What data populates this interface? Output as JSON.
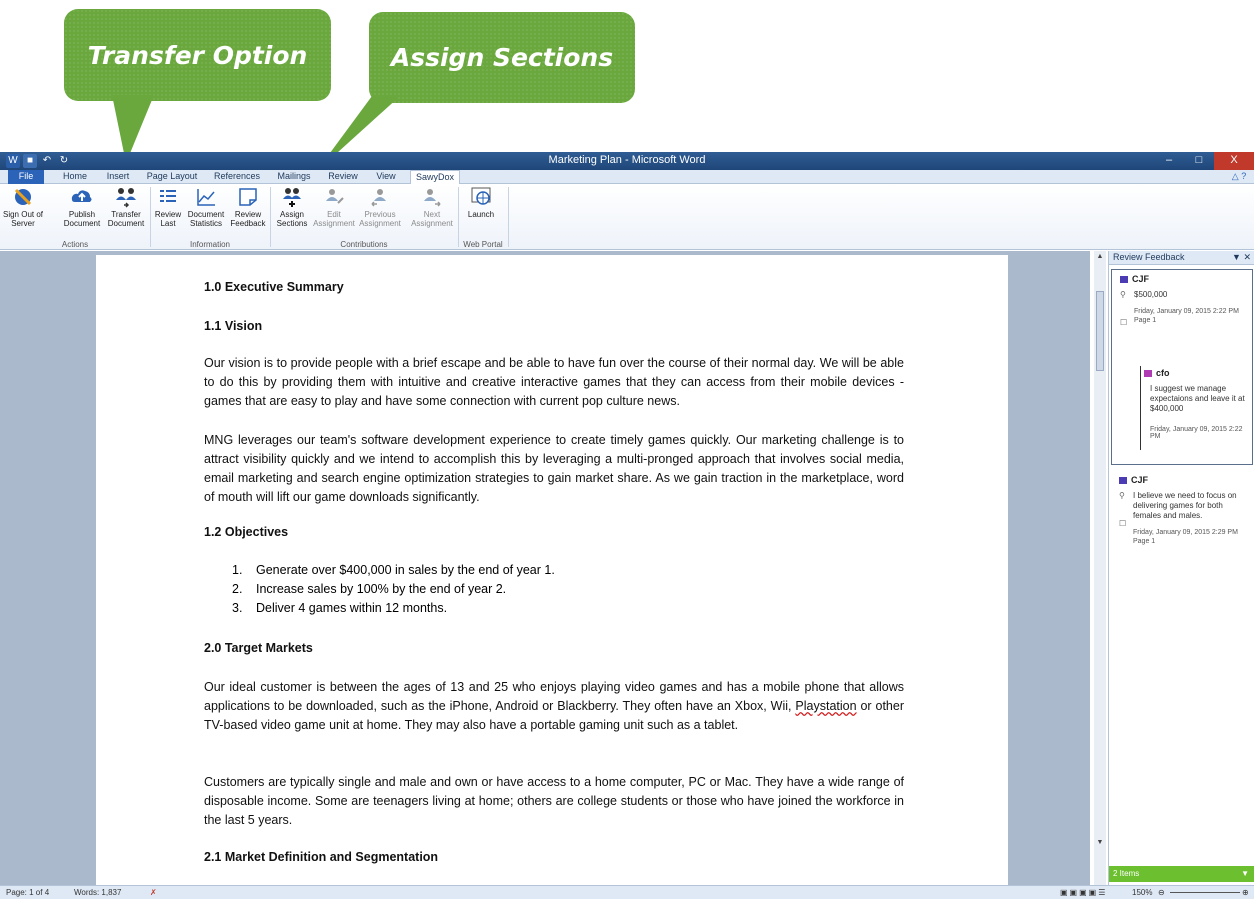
{
  "callouts": {
    "transfer": "Transfer Option",
    "assign": "Assign Sections"
  },
  "window": {
    "title": "Marketing Plan - Microsoft Word",
    "controls": [
      "–",
      "□",
      "X"
    ]
  },
  "tabs": [
    "File",
    "Home",
    "Insert",
    "Page Layout",
    "References",
    "Mailings",
    "Review",
    "View",
    "SawyDox"
  ],
  "ribbon": {
    "actions": {
      "label": "Actions",
      "buttons": [
        {
          "l1": "Sign Out of",
          "l2": "Server"
        },
        {
          "l1": "Publish",
          "l2": "Document"
        },
        {
          "l1": "Transfer",
          "l2": "Document"
        }
      ]
    },
    "information": {
      "label": "Information",
      "buttons": [
        {
          "l1": "Review",
          "l2": "Last"
        },
        {
          "l1": "Document",
          "l2": "Statistics"
        },
        {
          "l1": "Review",
          "l2": "Feedback"
        }
      ]
    },
    "contributions": {
      "label": "Contributions",
      "buttons": [
        {
          "l1": "Assign",
          "l2": "Sections"
        },
        {
          "l1": "Edit",
          "l2": "Assignment"
        },
        {
          "l1": "Previous",
          "l2": "Assignment"
        },
        {
          "l1": "Next",
          "l2": "Assignment"
        }
      ]
    },
    "webportal": {
      "label": "Web Portal",
      "buttons": [
        {
          "l1": "Launch",
          "l2": ""
        }
      ]
    }
  },
  "document": {
    "h1": "1.0 Executive Summary",
    "h2": "1.1 Vision",
    "p1": "Our vision is to provide people with a brief escape and be able to have fun over the course of their normal day. We will be able to do this by providing them with intuitive and creative interactive games that they can access from their mobile devices - games that are easy to play and have some connection with current pop culture news.",
    "p2": "MNG leverages our team's software development experience to create timely games quickly. Our marketing challenge is to attract visibility quickly and we intend to accomplish this by leveraging a multi-pronged approach that involves social media, email marketing and search engine optimization strategies to gain market share. As we gain traction in the marketplace, word of mouth will lift our game downloads significantly.",
    "h3": "1.2 Objectives",
    "objectives": [
      {
        "num": "1.",
        "text": "Generate over $400,000 in sales by the end of year 1."
      },
      {
        "num": "2.",
        "text": "Increase sales by 100% by the end of year 2."
      },
      {
        "num": "3.",
        "text": "Deliver 4 games within 12 months."
      }
    ],
    "h4": "2.0 Target Markets",
    "p3a": "Our ideal customer is between the ages of 13 and 25 who enjoys playing video games and has a mobile phone that allows applications to be downloaded, such as the iPhone, Android or Blackberry. They often have an Xbox, Wii, ",
    "p3word": "Playstation",
    "p3b": " or other TV-based video game unit at home. They may also have a portable gaming unit such as a tablet.",
    "p4": "Customers are typically single and male and own or have access to a home computer, PC or Mac. They have a wide range of disposable income. Some are teenagers living at home; others are college students or those who have joined the workforce in the last 5 years.",
    "h5": "2.1 Market Definition and Segmentation"
  },
  "pane": {
    "title": "Review Feedback",
    "c1": {
      "author": "CJF",
      "text": "$500,000",
      "date": "Friday, January 09, 2015 2:22 PM",
      "page": "Page 1"
    },
    "reply": {
      "author": "cfo",
      "text": "I suggest we manage expectaions and leave it at $400,000",
      "date": "Friday, January 09, 2015 2:22 PM"
    },
    "c2": {
      "author": "CJF",
      "text": "I believe we need to focus on delivering games for both females and males.",
      "date": "Friday, January 09, 2015 2:29 PM",
      "page": "Page 1"
    },
    "footer": "2 Items"
  },
  "status": {
    "page": "Page: 1 of 4",
    "words": "Words: 1,837",
    "zoom": "150%"
  }
}
